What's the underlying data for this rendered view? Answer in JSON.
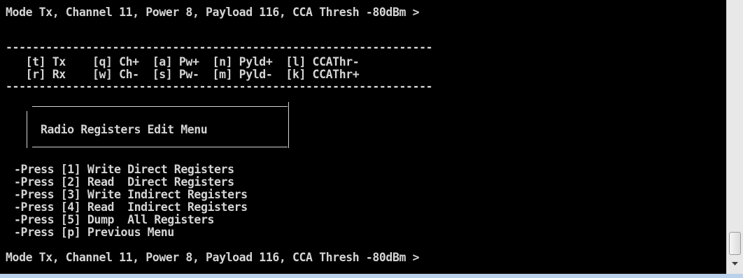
{
  "console": {
    "status_line_top": "Mode Tx, Channel 11, Power 8, Payload 116, CCA Thresh -80dBm >",
    "rule_top": "----------------------------------------------------------------",
    "shortcut_row1": "   [t] Tx    [q] Ch+  [a] Pw+  [n] Pyld+  [l] CCAThr-",
    "shortcut_row2": "   [r] Rx    [w] Ch-  [s] Pw-  [m] Pyld-  [k] CCAThr+",
    "rule_bottom": "----------------------------------------------------------------",
    "menu_title": "Radio Registers Edit Menu",
    "menu_items": [
      "-Press [1] Write Direct Registers",
      "-Press [2] Read  Direct Registers",
      "-Press [3] Write Indirect Registers",
      "-Press [4] Read  Indirect Registers",
      "-Press [5] Dump  All Registers",
      "-Press [p] Previous Menu"
    ],
    "status_line_bottom": "Mode Tx, Channel 11, Power 8, Payload 116, CCA Thresh -80dBm >"
  },
  "colors": {
    "console_background": "#000000",
    "console_text": "#d4d4d4",
    "scrollbar_track": "#e8e8e8",
    "window_frame": "#b9d1ea"
  },
  "icons": {
    "scroll_down": "chevron-down-icon"
  }
}
